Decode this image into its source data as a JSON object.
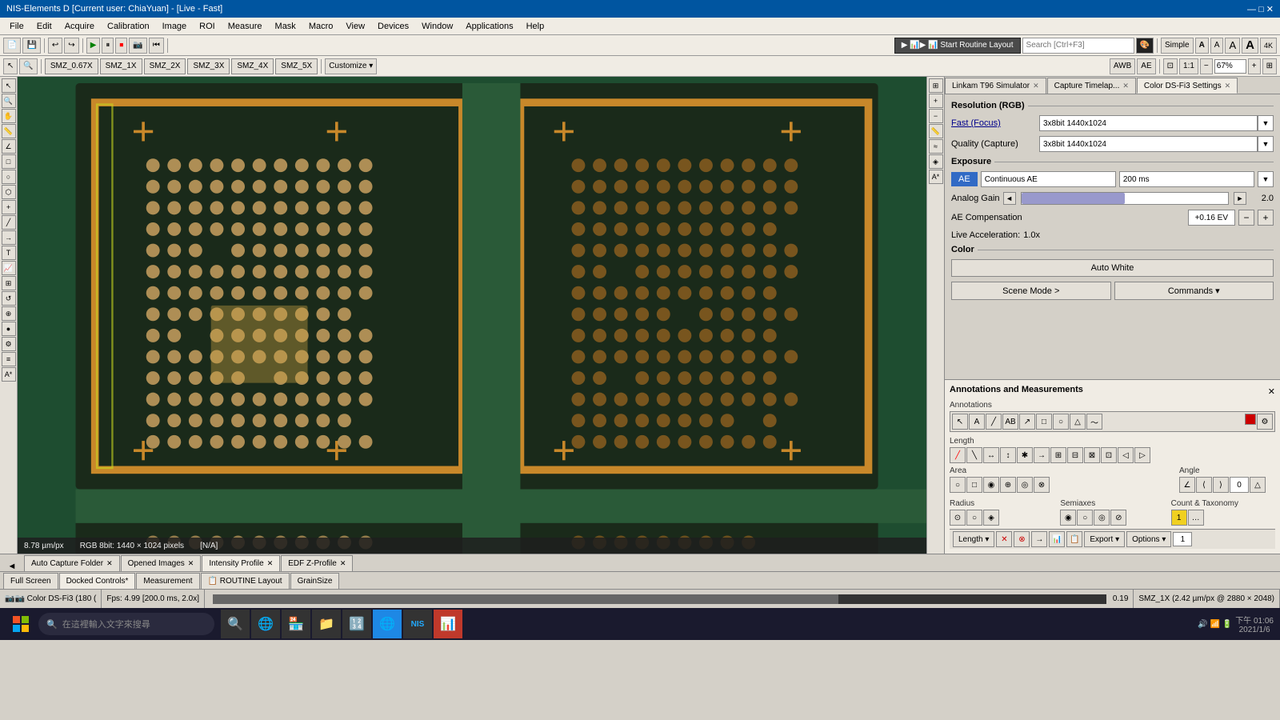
{
  "titleBar": {
    "title": "NIS-Elements D [Current user: ChiaYuan] - [Live - Fast]",
    "controls": [
      "—",
      "□",
      "✕"
    ]
  },
  "menuBar": {
    "items": [
      "File",
      "Edit",
      "Acquire",
      "Calibration",
      "Image",
      "ROI",
      "Measure",
      "Mask",
      "Macro",
      "View",
      "Devices",
      "Window",
      "Applications",
      "Help"
    ]
  },
  "toolbar1": {
    "routineBtn": "▶ 📊 Start Routine Layout",
    "searchPlaceholder": "Search [Ctrl+F3]",
    "simpleLabel": "Simple",
    "fontA1": "A",
    "fontA2": "A",
    "fontA3": "A",
    "fontA4": "A",
    "fontSz": "4K"
  },
  "toolbar2": {
    "magLabel": "SMZ_0.67X",
    "mag1": "SMZ_1X",
    "mag2": "SMZ_2X",
    "mag3": "SMZ_3X",
    "mag4": "SMZ_4X",
    "mag5": "SMZ_5X",
    "customizeBtn": "Customize ▾",
    "awb": "AWB",
    "ae": "AE",
    "zoom": "67%",
    "scale": "1:1"
  },
  "imageInfo": {
    "scale": "8.78 µm/px",
    "colorInfo": "RGB 8bit: 1440 × 1024 pixels",
    "value": "[N/A]"
  },
  "rightPanel": {
    "tabs": [
      {
        "label": "Linkam T96 Simulator",
        "active": false,
        "closable": true
      },
      {
        "label": "Capture Timelap...",
        "active": false,
        "closable": true
      },
      {
        "label": "Color DS-Fi3 Settings",
        "active": true,
        "closable": true
      }
    ],
    "resolution": {
      "title": "Resolution (RGB)",
      "fastLabel": "Fast (Focus)",
      "fastValue": "3x8bit 1440x1024",
      "qualityLabel": "Quality (Capture)",
      "qualityValue": "3x8bit 1440x1024"
    },
    "exposure": {
      "title": "Exposure",
      "aeBtn": "AE",
      "continuousAE": "Continuous AE",
      "timeValue": "200 ms"
    },
    "analogGain": {
      "label": "Analog Gain",
      "value": "2.0"
    },
    "aeCompensation": {
      "label": "AE Compensation",
      "value": "+0.16 EV"
    },
    "liveAcceleration": {
      "label": "Live Acceleration:",
      "value": "1.0x"
    },
    "color": {
      "title": "Color",
      "autoWhiteBtn": "Auto White"
    },
    "sceneMode": "Scene Mode >",
    "commands": "Commands ▾"
  },
  "annotations": {
    "title": "Annotations and Measurements",
    "sections": {
      "annotations": "Annotations",
      "length": "Length",
      "area": "Area",
      "angle": "Angle",
      "angleValue": "0",
      "radius": "Radius",
      "semiaxes": "Semiaxes",
      "countTaxonomy": "Count & Taxonomy"
    },
    "bottomBar": {
      "lengthLabel": "Length ▾",
      "exportBtn": "Export ▾",
      "optionsBtn": "Options ▾",
      "countValue": "1"
    }
  },
  "bottomTabs": {
    "tabs": [
      {
        "label": "Auto Capture Folder",
        "active": false,
        "closable": true
      },
      {
        "label": "Opened Images",
        "active": false,
        "closable": true
      },
      {
        "label": "Intensity Profile",
        "active": false,
        "closable": true
      },
      {
        "label": "EDF Z-Profile",
        "active": false,
        "closable": true
      }
    ]
  },
  "layoutTabs": {
    "tabs": [
      {
        "label": "Full Screen",
        "active": false
      },
      {
        "label": "Docked Controls*",
        "active": true
      },
      {
        "label": "Measurement",
        "active": false
      },
      {
        "label": "📋 ROUTINE Layout",
        "active": false
      },
      {
        "label": "GrainSize",
        "active": false
      }
    ]
  },
  "statusBar": {
    "cameraInfo": "📷 Color DS-Fi3 (180 (",
    "fps": "Fps: 4.99 [200.0 ms, 2.0x]",
    "progressValue": "0.19",
    "magnification": "SMZ_1X (2.42 µm/px @ 2880 × 2048)"
  },
  "taskbar": {
    "time": "下午 01:06",
    "date": "2021/1/6"
  }
}
